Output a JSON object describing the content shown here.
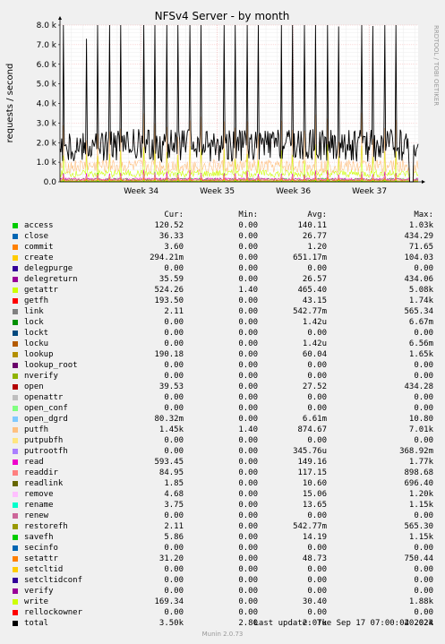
{
  "chart_data": {
    "type": "line",
    "title": "NFSv4 Server - by month",
    "ylabel": "requests / second",
    "side_text": "RRDTOOL / TOBI OETIKER",
    "ylim": [
      0,
      8000
    ],
    "y_ticks": [
      {
        "value": 0,
        "label": "0.0"
      },
      {
        "value": 1000,
        "label": "1.0 k"
      },
      {
        "value": 2000,
        "label": "2.0 k"
      },
      {
        "value": 3000,
        "label": "3.0 k"
      },
      {
        "value": 4000,
        "label": "4.0 k"
      },
      {
        "value": 5000,
        "label": "5.0 k"
      },
      {
        "value": 6000,
        "label": "6.0 k"
      },
      {
        "value": 7000,
        "label": "7.0 k"
      },
      {
        "value": 8000,
        "label": "8.0 k"
      }
    ],
    "x_ticks": [
      {
        "position": 0.2267,
        "label": "Week 34"
      },
      {
        "position": 0.4391,
        "label": "Week 35"
      },
      {
        "position": 0.6516,
        "label": "Week 36"
      },
      {
        "position": 0.864,
        "label": "Week 37"
      }
    ],
    "grid": true,
    "columns": [
      "Cur:",
      "Min:",
      "Avg:",
      "Max:"
    ],
    "series": [
      {
        "name": "access",
        "color": "#00cc00",
        "cur": "120.52",
        "min": "0.00",
        "avg": "140.11",
        "max": "1.03k"
      },
      {
        "name": "close",
        "color": "#0066b3",
        "cur": "36.33",
        "min": "0.00",
        "avg": "26.77",
        "max": "434.29"
      },
      {
        "name": "commit",
        "color": "#ff8000",
        "cur": "3.60",
        "min": "0.00",
        "avg": "1.20",
        "max": "71.65"
      },
      {
        "name": "create",
        "color": "#ffcc00",
        "cur": "294.21m",
        "min": "0.00",
        "avg": "651.17m",
        "max": "104.03"
      },
      {
        "name": "delegpurge",
        "color": "#330099",
        "cur": "0.00",
        "min": "0.00",
        "avg": "0.00",
        "max": "0.00"
      },
      {
        "name": "delegreturn",
        "color": "#990099",
        "cur": "35.59",
        "min": "0.00",
        "avg": "26.57",
        "max": "434.06"
      },
      {
        "name": "getattr",
        "color": "#ccff00",
        "cur": "524.26",
        "min": "1.40",
        "avg": "465.40",
        "max": "5.08k"
      },
      {
        "name": "getfh",
        "color": "#ff0000",
        "cur": "193.50",
        "min": "0.00",
        "avg": "43.15",
        "max": "1.74k"
      },
      {
        "name": "link",
        "color": "#808080",
        "cur": "2.11",
        "min": "0.00",
        "avg": "542.77m",
        "max": "565.34"
      },
      {
        "name": "lock",
        "color": "#008f00",
        "cur": "0.00",
        "min": "0.00",
        "avg": "1.42u",
        "max": "6.67m"
      },
      {
        "name": "lockt",
        "color": "#00487d",
        "cur": "0.00",
        "min": "0.00",
        "avg": "0.00",
        "max": "0.00"
      },
      {
        "name": "locku",
        "color": "#b35a00",
        "cur": "0.00",
        "min": "0.00",
        "avg": "1.42u",
        "max": "6.56m"
      },
      {
        "name": "lookup",
        "color": "#b38f00",
        "cur": "190.18",
        "min": "0.00",
        "avg": "60.04",
        "max": "1.65k"
      },
      {
        "name": "lookup_root",
        "color": "#6b006b",
        "cur": "0.00",
        "min": "0.00",
        "avg": "0.00",
        "max": "0.00"
      },
      {
        "name": "nverify",
        "color": "#8fb300",
        "cur": "0.00",
        "min": "0.00",
        "avg": "0.00",
        "max": "0.00"
      },
      {
        "name": "open",
        "color": "#b30000",
        "cur": "39.53",
        "min": "0.00",
        "avg": "27.52",
        "max": "434.28"
      },
      {
        "name": "openattr",
        "color": "#bebebe",
        "cur": "0.00",
        "min": "0.00",
        "avg": "0.00",
        "max": "0.00"
      },
      {
        "name": "open_conf",
        "color": "#80ff80",
        "cur": "0.00",
        "min": "0.00",
        "avg": "0.00",
        "max": "0.00"
      },
      {
        "name": "open_dgrd",
        "color": "#80c9ff",
        "cur": "80.32m",
        "min": "0.00",
        "avg": "6.61m",
        "max": "10.80"
      },
      {
        "name": "putfh",
        "color": "#ffc080",
        "cur": "1.45k",
        "min": "1.40",
        "avg": "874.67",
        "max": "7.01k"
      },
      {
        "name": "putpubfh",
        "color": "#ffe680",
        "cur": "0.00",
        "min": "0.00",
        "avg": "0.00",
        "max": "0.00"
      },
      {
        "name": "putrootfh",
        "color": "#aa80ff",
        "cur": "0.00",
        "min": "0.00",
        "avg": "345.76u",
        "max": "368.92m"
      },
      {
        "name": "read",
        "color": "#ee00cc",
        "cur": "593.45",
        "min": "0.00",
        "avg": "149.16",
        "max": "1.77k"
      },
      {
        "name": "readdir",
        "color": "#ff8080",
        "cur": "84.95",
        "min": "0.00",
        "avg": "117.15",
        "max": "898.68"
      },
      {
        "name": "readlink",
        "color": "#666600",
        "cur": "1.85",
        "min": "0.00",
        "avg": "10.60",
        "max": "696.40"
      },
      {
        "name": "remove",
        "color": "#ffbfff",
        "cur": "4.68",
        "min": "0.00",
        "avg": "15.06",
        "max": "1.20k"
      },
      {
        "name": "rename",
        "color": "#00ffcc",
        "cur": "3.75",
        "min": "0.00",
        "avg": "13.65",
        "max": "1.15k"
      },
      {
        "name": "renew",
        "color": "#cc6699",
        "cur": "0.00",
        "min": "0.00",
        "avg": "0.00",
        "max": "0.00"
      },
      {
        "name": "restorefh",
        "color": "#999900",
        "cur": "2.11",
        "min": "0.00",
        "avg": "542.77m",
        "max": "565.30"
      },
      {
        "name": "savefh",
        "color": "#00cc00",
        "cur": "5.86",
        "min": "0.00",
        "avg": "14.19",
        "max": "1.15k"
      },
      {
        "name": "secinfo",
        "color": "#0066b3",
        "cur": "0.00",
        "min": "0.00",
        "avg": "0.00",
        "max": "0.00"
      },
      {
        "name": "setattr",
        "color": "#ff8000",
        "cur": "31.20",
        "min": "0.00",
        "avg": "48.73",
        "max": "750.44"
      },
      {
        "name": "setcltid",
        "color": "#ffcc00",
        "cur": "0.00",
        "min": "0.00",
        "avg": "0.00",
        "max": "0.00"
      },
      {
        "name": "setcltidconf",
        "color": "#330099",
        "cur": "0.00",
        "min": "0.00",
        "avg": "0.00",
        "max": "0.00"
      },
      {
        "name": "verify",
        "color": "#990099",
        "cur": "0.00",
        "min": "0.00",
        "avg": "0.00",
        "max": "0.00"
      },
      {
        "name": "write",
        "color": "#ccff00",
        "cur": "169.34",
        "min": "0.00",
        "avg": "30.40",
        "max": "1.88k"
      },
      {
        "name": "rellockowner",
        "color": "#ff0000",
        "cur": "0.00",
        "min": "0.00",
        "avg": "0.00",
        "max": "0.00"
      },
      {
        "name": "total",
        "color": "#000000",
        "cur": "3.50k",
        "min": "2.80",
        "avg": "2.07k",
        "max": "20.02k"
      }
    ]
  },
  "footer": {
    "last_update": "Last update: Tue Sep 17 07:00:04 2024",
    "version": "Munin 2.0.73"
  }
}
